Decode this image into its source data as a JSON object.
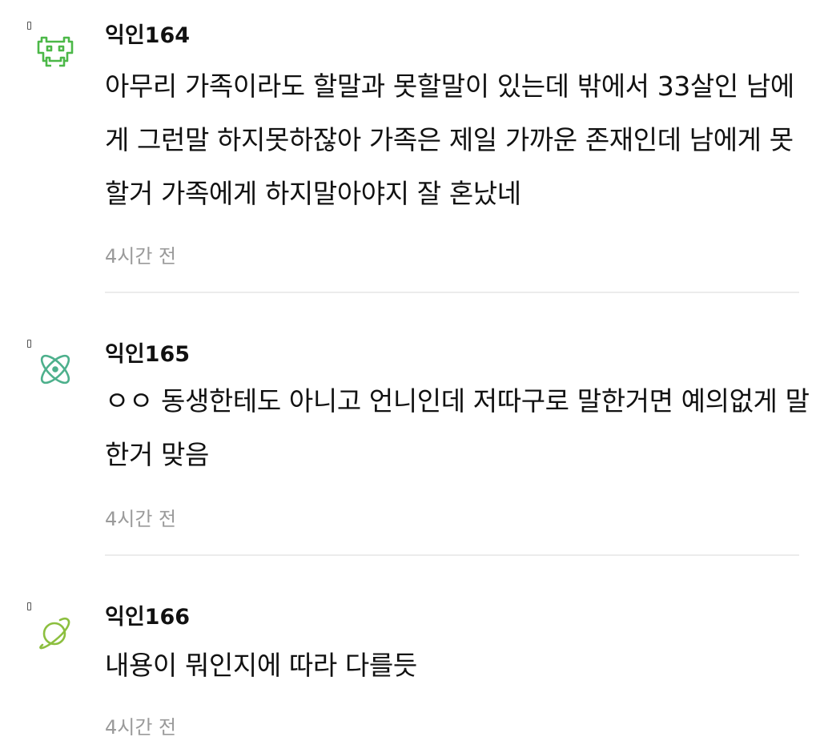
{
  "comments": [
    {
      "author": "익인164",
      "text": "아무리 가족이라도 할말과 못할말이 있는데 밖에서 33살인 남에게 그런말 하지못하잖아 가족은 제일 가까운 존재인데 남에게 못할거 가족에게 하지말아야지 잘 혼났네",
      "time": "4시간 전",
      "avatar_icon": "space-invader-icon",
      "avatar_color": "#4cb848"
    },
    {
      "author": "익인165",
      "text": "ㅇㅇ 동생한테도 아니고 언니인데 저따구로 말한거면 예의없게 말한거 맞음",
      "time": "4시간 전",
      "avatar_icon": "atom-icon",
      "avatar_color": "#4db08c"
    },
    {
      "author": "익인166",
      "text": "내용이 뭐인지에 따라 다를듯",
      "time": "4시간 전",
      "avatar_icon": "planet-icon",
      "avatar_color": "#8cbf3f"
    }
  ]
}
